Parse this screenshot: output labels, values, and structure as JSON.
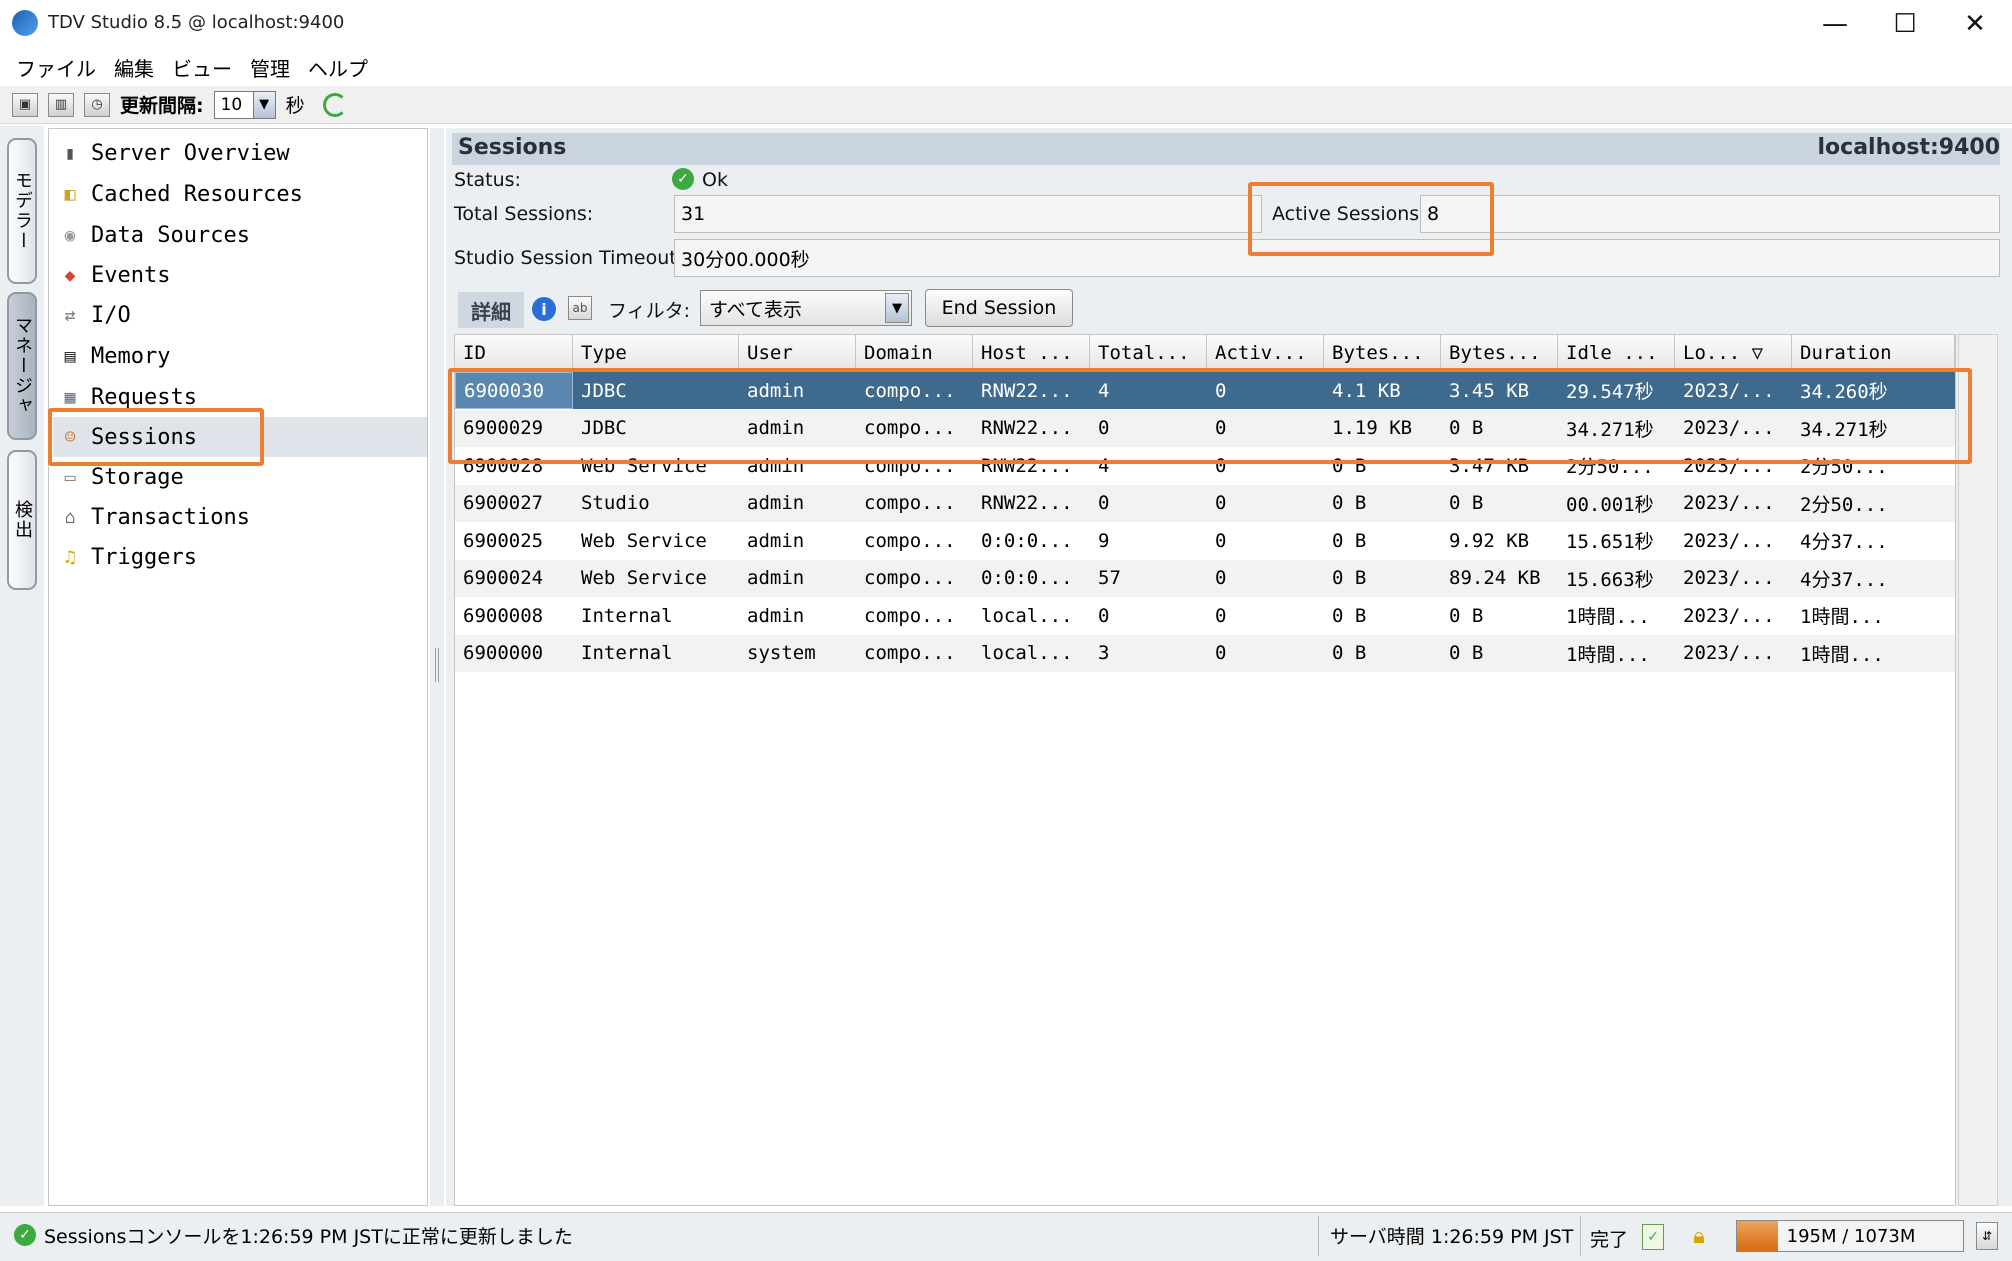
{
  "window": {
    "title": "TDV Studio 8.5 @ localhost:9400",
    "minimize": "—",
    "maximize": "☐",
    "close": "✕"
  },
  "menu": [
    "ファイル",
    "編集",
    "ビュー",
    "管理",
    "ヘルプ"
  ],
  "toolbar": {
    "refresh_label": "更新間隔:",
    "refresh_value": "10",
    "refresh_unit": "秒"
  },
  "side_tabs": [
    "モデラー",
    "マネージャ",
    "検出"
  ],
  "nav": {
    "selected": "Sessions",
    "items": [
      {
        "label": "Server Overview",
        "icon": "server-icon"
      },
      {
        "label": "Cached Resources",
        "icon": "cache-icon"
      },
      {
        "label": "Data Sources",
        "icon": "database-icon"
      },
      {
        "label": "Events",
        "icon": "events-icon"
      },
      {
        "label": "I/O",
        "icon": "io-icon"
      },
      {
        "label": "Memory",
        "icon": "memory-icon"
      },
      {
        "label": "Requests",
        "icon": "requests-icon"
      },
      {
        "label": "Sessions",
        "icon": "users-icon"
      },
      {
        "label": "Storage",
        "icon": "storage-icon"
      },
      {
        "label": "Transactions",
        "icon": "bank-icon"
      },
      {
        "label": "Triggers",
        "icon": "bell-icon"
      }
    ]
  },
  "sessions": {
    "title": "Sessions",
    "host": "localhost:9400",
    "status_label": "Status:",
    "status_value": "Ok",
    "total_label": "Total Sessions:",
    "total_value": "31",
    "active_label": "Active Sessions:",
    "active_value": "8",
    "timeout_label": "Studio Session Timeout:",
    "timeout_value": "30分00.000秒",
    "detail_label": "詳細",
    "filter_label": "フィルタ:",
    "filter_value": "すべて表示",
    "end_session": "End Session"
  },
  "table": {
    "columns": [
      "ID",
      "Type",
      "User",
      "Domain",
      "Host ...",
      "Total...",
      "Activ...",
      "Bytes...",
      "Bytes...",
      "Idle ...",
      "Lo... ▽",
      "Duration"
    ],
    "rows": [
      [
        "6900030",
        "JDBC",
        "admin",
        "compo...",
        "RNW22...",
        "4",
        "0",
        "4.1 KB",
        "3.45 KB",
        "29.547秒",
        "2023/...",
        "34.260秒"
      ],
      [
        "6900029",
        "JDBC",
        "admin",
        "compo...",
        "RNW22...",
        "0",
        "0",
        "1.19 KB",
        "0 B",
        "34.271秒",
        "2023/...",
        "34.271秒"
      ],
      [
        "6900028",
        "Web Service",
        "admin",
        "compo...",
        "RNW22...",
        "4",
        "0",
        "0 B",
        "3.47 KB",
        "2分50...",
        "2023/...",
        "2分50..."
      ],
      [
        "6900027",
        "Studio",
        "admin",
        "compo...",
        "RNW22...",
        "0",
        "0",
        "0 B",
        "0 B",
        "00.001秒",
        "2023/...",
        "2分50..."
      ],
      [
        "6900025",
        "Web Service",
        "admin",
        "compo...",
        "0:0:0...",
        "9",
        "0",
        "0 B",
        "9.92 KB",
        "15.651秒",
        "2023/...",
        "4分37..."
      ],
      [
        "6900024",
        "Web Service",
        "admin",
        "compo...",
        "0:0:0...",
        "57",
        "0",
        "0 B",
        "89.24 KB",
        "15.663秒",
        "2023/...",
        "4分37..."
      ],
      [
        "6900008",
        "Internal",
        "admin",
        "compo...",
        "local...",
        "0",
        "0",
        "0 B",
        "0 B",
        "1時間...",
        "2023/...",
        "1時間..."
      ],
      [
        "6900000",
        "Internal",
        "system",
        "compo...",
        "local...",
        "3",
        "0",
        "0 B",
        "0 B",
        "1時間...",
        "2023/...",
        "1時間..."
      ]
    ]
  },
  "status_bar": {
    "message": "Sessionsコンソールを1:26:59 PM JSTに正常に更新しました",
    "server_time": "サーバ時間  1:26:59 PM JST",
    "done": "完了",
    "memory": "195M / 1073M",
    "memory_fraction": 0.18
  },
  "colors": {
    "highlight": "#ed7d31",
    "selected_row": "#3e6a8e"
  }
}
